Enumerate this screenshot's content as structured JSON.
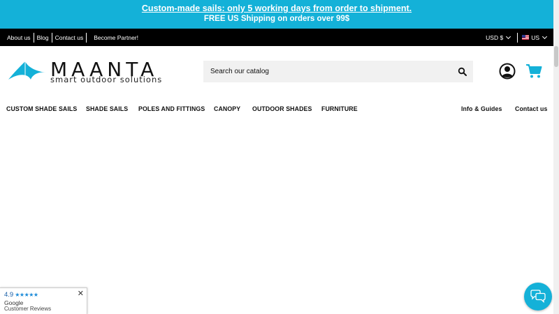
{
  "promo": {
    "line1": "Custom-made sails: only 5 working days from order to shipment.",
    "line2": "FREE US Shipping on orders over 99$",
    "color": "#14b1d8"
  },
  "topbar": {
    "links": [
      "About us",
      "Blog",
      "Contact us",
      "Become Partner!"
    ],
    "currency": "USD $",
    "language": "US"
  },
  "header": {
    "logo_word": "MAANTA",
    "logo_tagline": "smart outdoor solutions",
    "search_placeholder": "Search our catalog",
    "icons": [
      "search-icon",
      "account-icon",
      "cart-icon"
    ]
  },
  "nav": {
    "items": [
      "CUSTOM SHADE SAILS",
      "SHADE SAILS",
      "POLES AND FITTINGS",
      "CANOPY",
      "OUTDOOR SHADES",
      "FURNITURE"
    ],
    "right_items": [
      "Info & Guides",
      "Contact us"
    ]
  },
  "reviews_badge": {
    "rating": "4.9",
    "stars": "★★★★★",
    "source": "Google",
    "subtitle": "Customer Reviews",
    "close": "✕"
  },
  "chat": {
    "icon": "chat-bubbles-icon"
  }
}
